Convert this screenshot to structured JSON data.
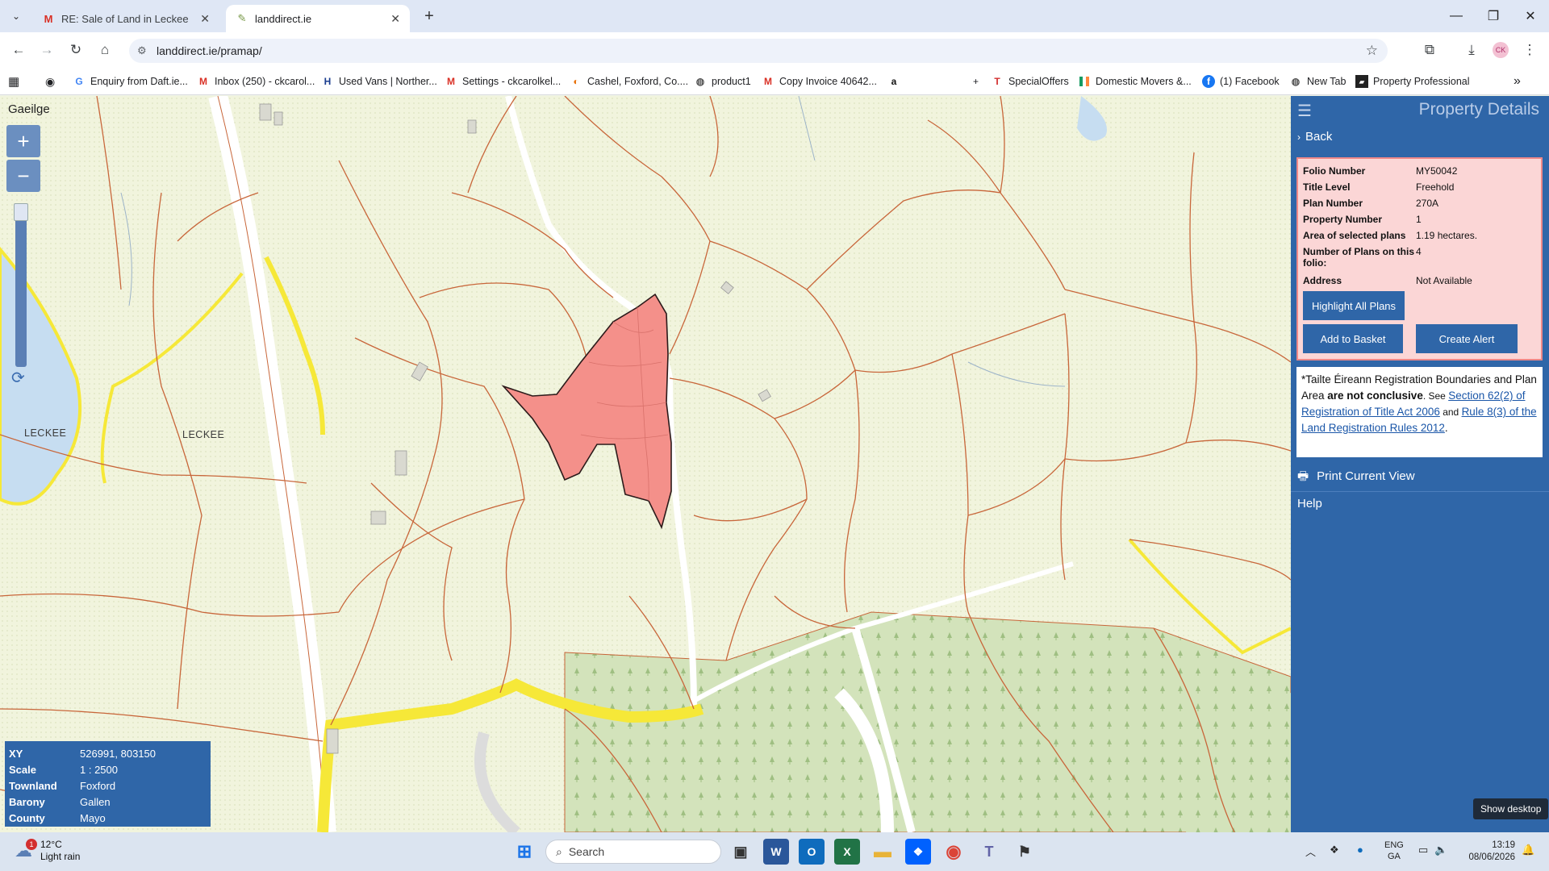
{
  "browser": {
    "tabs": [
      {
        "title": "RE: Sale of Land in Leckee - info",
        "active": false,
        "icon": "gmail-icon"
      },
      {
        "title": "landdirect.ie",
        "active": true,
        "icon": "leaf-icon"
      }
    ],
    "url": "landdirect.ie/pramap/",
    "bookmarks": [
      {
        "label": "Enquiry from Daft.ie...",
        "icon": "google-icon"
      },
      {
        "label": "Inbox (250) - ckcarol...",
        "icon": "gmail-icon"
      },
      {
        "label": "Used Vans | Norther...",
        "icon": "h-icon"
      },
      {
        "label": "Settings - ckcarolkel...",
        "icon": "gmail-icon"
      },
      {
        "label": "Cashel, Foxford, Co....",
        "icon": "map-icon"
      },
      {
        "label": "product1",
        "icon": "globe-icon"
      },
      {
        "label": "Copy Invoice 40642...",
        "icon": "gmail-icon"
      },
      {
        "label": "a",
        "icon": "amazon-icon"
      },
      {
        "label": "SpecialOffers",
        "icon": "t-icon"
      },
      {
        "label": "Domestic Movers &...",
        "icon": "flag-icon"
      },
      {
        "label": "(1) Facebook",
        "icon": "facebook-icon"
      },
      {
        "label": "New Tab",
        "icon": "globe-icon"
      },
      {
        "label": "Property Professional",
        "icon": "pp-icon"
      }
    ],
    "more": "»"
  },
  "map": {
    "language_link": "Gaeilge",
    "zoom_in": "+",
    "zoom_out": "−",
    "place_names": [
      "LECKEE",
      "LECKEE"
    ],
    "colors": {
      "selected_parcel": "#f4908a",
      "parcel_boundary": "#c8663a",
      "road": "#f6e838",
      "forest": "#cfe0b4"
    }
  },
  "info_box": {
    "rows": [
      {
        "label": "XY",
        "value": "526991, 803150"
      },
      {
        "label": "Scale",
        "value": "1 : 2500"
      },
      {
        "label": "Townland",
        "value": "Foxford"
      },
      {
        "label": "Barony",
        "value": "Gallen"
      },
      {
        "label": "County",
        "value": "Mayo"
      }
    ]
  },
  "panel": {
    "title": "Property Details",
    "back": "Back",
    "details": [
      {
        "label": "Folio Number",
        "value": "MY50042"
      },
      {
        "label": "Title Level",
        "value": "Freehold"
      },
      {
        "label": "Plan Number",
        "value": "270A"
      },
      {
        "label": "Property Number",
        "value": "1"
      },
      {
        "label": "Area of selected plans",
        "value": "1.19 hectares."
      },
      {
        "label": "Number of Plans on this folio:",
        "value": "4"
      },
      {
        "label": "Address",
        "value": "Not Available"
      }
    ],
    "buttons": {
      "highlight": "Highlight All Plans",
      "basket": "Add to Basket",
      "alert": "Create Alert"
    },
    "note": {
      "part1": "*Tailte Éireann Registration Boundaries and Plan Area ",
      "bold": "are not conclusive",
      "part2": ". See ",
      "link1": "Section 62(2) of Registration of Title Act 2006",
      "part3": " and ",
      "link2": "Rule 8(3) of the Land Registration Rules 2012",
      "part4": "."
    },
    "print": "Print Current View",
    "help": "Help"
  },
  "show_desktop": "Show desktop",
  "taskbar": {
    "weather_temp": "12°C",
    "weather_desc": "Light rain",
    "weather_badge": "1",
    "search_placeholder": "Search",
    "lang_top": "ENG",
    "lang_bottom": "GA",
    "time": "13:19",
    "date": "08/06/2026"
  }
}
